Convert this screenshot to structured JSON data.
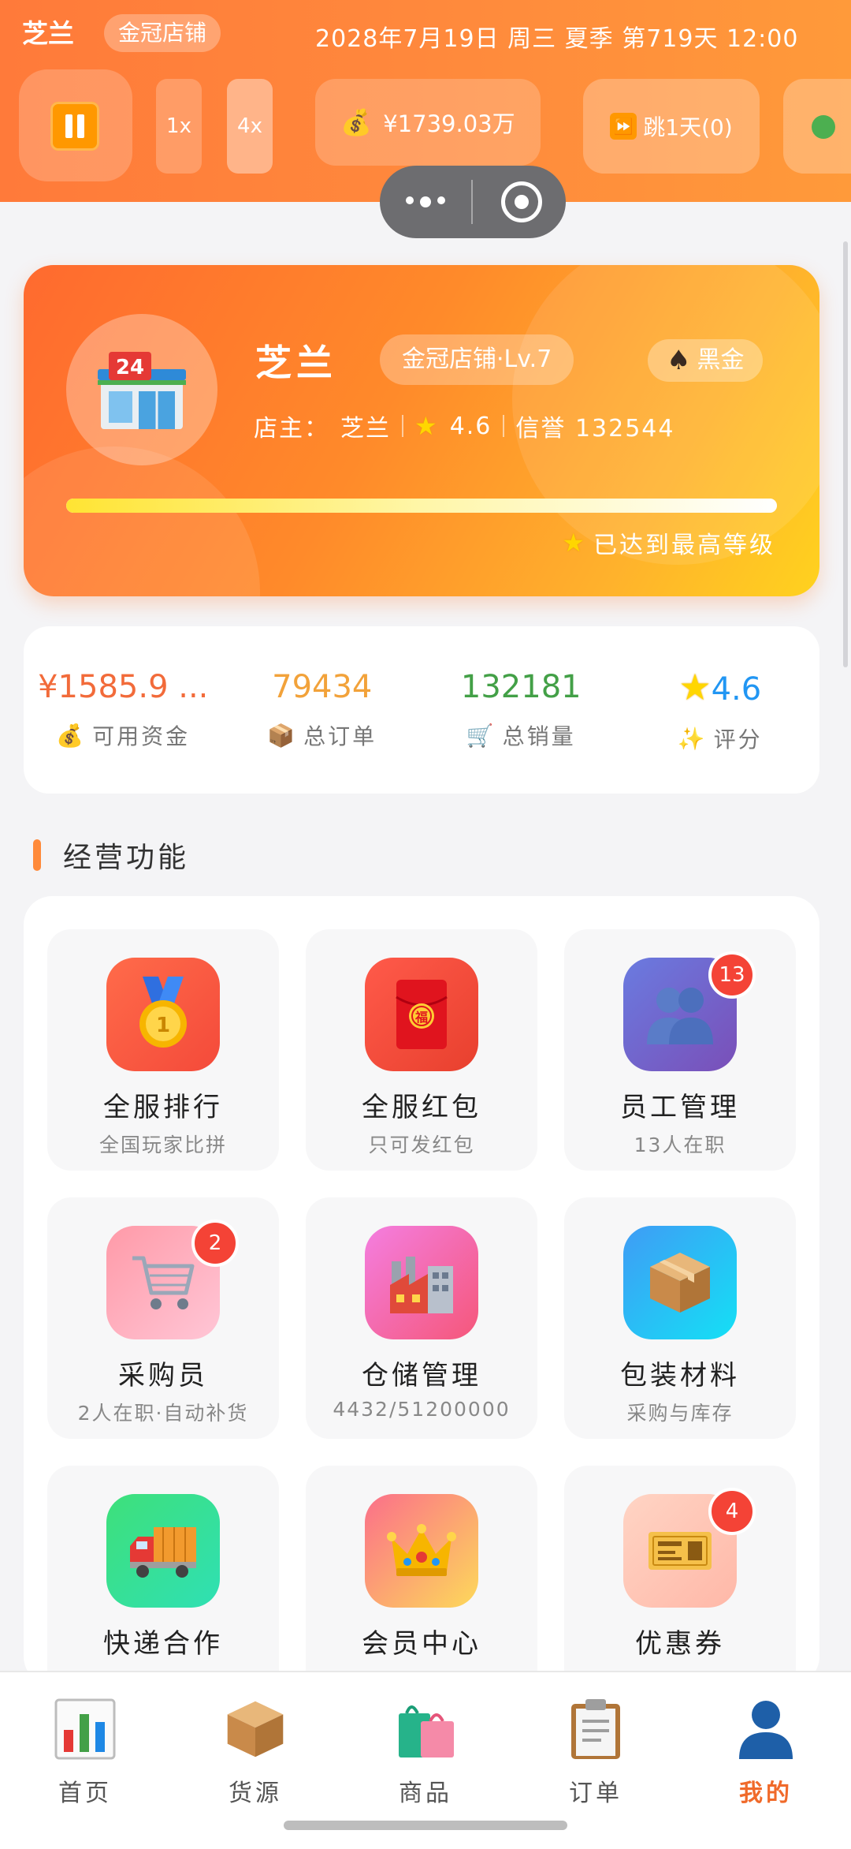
{
  "topbar": {
    "shop_name": "芝兰",
    "shop_tag": "金冠店铺",
    "datetime": "2028年7月19日 周三 夏季 第719天 12:00",
    "speed_1x": "1x",
    "speed_4x": "4x",
    "money": "¥1739.03万",
    "jump_label": "跳1天(0)",
    "icons": {
      "pause": "pause-icon",
      "money": "money-bag-icon",
      "jump": "fast-forward-icon"
    },
    "status_color": "#4caf50"
  },
  "hero": {
    "name": "芝兰",
    "level": "金冠店铺·Lv.7",
    "vip": "黑金",
    "owner_label": "店主：",
    "owner_name": "芝兰",
    "rating": "4.6",
    "credit": "信誉 132544",
    "progress": 1.0,
    "max_text": "已达到最高等级",
    "store_icon": "convenience-store-24-icon"
  },
  "stats": [
    {
      "value": "¥1585.9 ...",
      "label": "可用资金",
      "emoji": "💰",
      "color": "#f26b3a"
    },
    {
      "value": "79434",
      "label": "总订单",
      "emoji": "📦",
      "color": "#f2a23a"
    },
    {
      "value": "132181",
      "label": "总销量",
      "emoji": "🛒",
      "color": "#43a047"
    },
    {
      "value": "4.6",
      "label": "评分",
      "emoji": "✨",
      "color": "#2196f3"
    }
  ],
  "section": {
    "title": "经营功能"
  },
  "features": [
    {
      "title": "全服排行",
      "sub": "全国玩家比拼",
      "badge": "",
      "icon": "medal-icon",
      "bg": "linear-gradient(135deg,#ff6b4a,#f44a3a)"
    },
    {
      "title": "全服红包",
      "sub": "只可发红包",
      "badge": "",
      "icon": "red-envelope-icon",
      "bg": "linear-gradient(135deg,#ff5a4a,#e8402e)"
    },
    {
      "title": "员工管理",
      "sub": "13人在职",
      "badge": "13",
      "icon": "people-icon",
      "bg": "linear-gradient(135deg,#6a7be0,#7a4fb8)"
    },
    {
      "title": "采购员",
      "sub": "2人在职·自动补货",
      "badge": "2",
      "icon": "shopping-cart-icon",
      "bg": "linear-gradient(135deg,#ff9aa8,#ffc6d6)"
    },
    {
      "title": "仓储管理",
      "sub": "4432/51200000",
      "badge": "",
      "icon": "factory-icon",
      "bg": "linear-gradient(135deg,#f47ee0,#f5577a)"
    },
    {
      "title": "包装材料",
      "sub": "采购与库存",
      "badge": "",
      "icon": "package-icon",
      "bg": "linear-gradient(135deg,#3f9cf5,#14e0f5)"
    },
    {
      "title": "快递合作",
      "sub": "",
      "badge": "",
      "icon": "delivery-truck-icon",
      "bg": "linear-gradient(135deg,#3ee07a,#2fe0b4)"
    },
    {
      "title": "会员中心",
      "sub": "",
      "badge": "",
      "icon": "crown-icon",
      "bg": "linear-gradient(135deg,#fb6f8a,#fdd95a)"
    },
    {
      "title": "优惠券",
      "sub": "",
      "badge": "4",
      "icon": "ticket-icon",
      "bg": "linear-gradient(135deg,#ffd4c4,#ffb8a8)"
    }
  ],
  "nav": [
    {
      "label": "首页",
      "icon": "bar-chart-icon",
      "active": false
    },
    {
      "label": "货源",
      "icon": "package-icon",
      "active": false
    },
    {
      "label": "商品",
      "icon": "shopping-bags-icon",
      "active": false
    },
    {
      "label": "订单",
      "icon": "clipboard-icon",
      "active": false
    },
    {
      "label": "我的",
      "icon": "user-icon",
      "active": true
    }
  ]
}
